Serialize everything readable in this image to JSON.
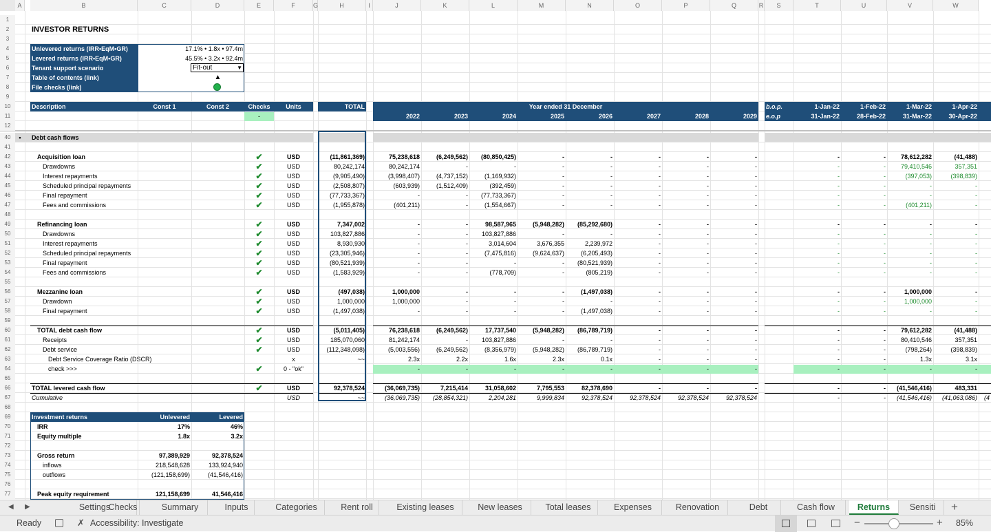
{
  "columns": [
    [
      "A",
      22,
      36
    ],
    [
      "B",
      44,
      200
    ],
    [
      "C",
      200,
      278
    ],
    [
      "D",
      278,
      355
    ],
    [
      "E",
      355,
      398
    ],
    [
      "F",
      398,
      455
    ],
    [
      "G",
      455,
      462
    ],
    [
      "H",
      462,
      532
    ],
    [
      "I",
      532,
      542
    ],
    [
      "J",
      542,
      612
    ],
    [
      "K",
      612,
      682
    ],
    [
      "L",
      682,
      752
    ],
    [
      "M",
      752,
      822
    ],
    [
      "N",
      822,
      892
    ],
    [
      "O",
      892,
      962
    ],
    [
      "P",
      962,
      1032
    ],
    [
      "Q",
      1032,
      1102
    ],
    [
      "R",
      1102,
      1111
    ],
    [
      "S",
      1111,
      1153
    ],
    [
      "T",
      1153,
      1222
    ],
    [
      "U",
      1222,
      1289
    ],
    [
      "V",
      1289,
      1356
    ],
    [
      "W",
      1356,
      1422
    ]
  ],
  "rows": [
    [
      "1",
      22
    ],
    [
      "2",
      36
    ],
    [
      "3",
      50
    ],
    [
      "4",
      64
    ],
    [
      "5",
      78
    ],
    [
      "6",
      92
    ],
    [
      "7",
      106
    ],
    [
      "8",
      120
    ],
    [
      "9",
      134
    ],
    [
      "10",
      148
    ],
    [
      "11",
      162
    ],
    [
      "12",
      176
    ],
    [
      "40",
      193
    ],
    [
      "41",
      207
    ],
    [
      "42",
      221
    ],
    [
      "43",
      235
    ],
    [
      "44",
      249
    ],
    [
      "45",
      263
    ],
    [
      "46",
      277
    ],
    [
      "47",
      291
    ],
    [
      "48",
      305
    ],
    [
      "49",
      319
    ],
    [
      "50",
      333
    ],
    [
      "51",
      347
    ],
    [
      "52",
      361
    ],
    [
      "53",
      375
    ],
    [
      "54",
      389
    ],
    [
      "55",
      403
    ],
    [
      "56",
      417
    ],
    [
      "57",
      431
    ],
    [
      "58",
      445
    ],
    [
      "59",
      459
    ],
    [
      "60",
      473
    ],
    [
      "61",
      487
    ],
    [
      "62",
      501
    ],
    [
      "63",
      515
    ],
    [
      "64",
      529
    ],
    [
      "65",
      543
    ],
    [
      "66",
      557
    ],
    [
      "67",
      571
    ],
    [
      "68",
      585
    ],
    [
      "69",
      599
    ],
    [
      "70",
      613
    ],
    [
      "71",
      627
    ],
    [
      "72",
      641
    ],
    [
      "73",
      655
    ],
    [
      "74",
      669
    ],
    [
      "75",
      683
    ],
    [
      "76",
      697
    ],
    [
      "77",
      711
    ]
  ],
  "title": "INVESTOR RETURNS",
  "summary": {
    "unlev_label": "Unlevered returns (IRR•EqM•GR)",
    "unlev_value": "17.1% • 1.8x • 97.4m",
    "lev_label": "Levered returns (IRR•EqM•GR)",
    "lev_value": "45.5% • 3.2x • 92.4m",
    "tenant_label": "Tenant support scenario",
    "tenant_value": "Fit-out",
    "toc_label": "Table of contents (link)",
    "toc_symbol": "▲",
    "checks_label": "File checks (link)",
    "checks_color": "#22b14c"
  },
  "header": {
    "description": "Description",
    "const1": "Const 1",
    "const2": "Const 2",
    "checks": "Checks",
    "units": "Units",
    "total": "TOTAL",
    "year_ended": "Year ended 31 December",
    "bop": "b.o.p.",
    "eop": "e.o.p",
    "check_dash": "-",
    "years": [
      "2022",
      "2023",
      "2024",
      "2025",
      "2026",
      "2027",
      "2028",
      "2029"
    ],
    "months_bop": [
      "1-Jan-22",
      "1-Feb-22",
      "1-Mar-22",
      "1-Apr-22"
    ],
    "months_eop": [
      "31-Jan-22",
      "28-Feb-22",
      "31-Mar-22",
      "30-Apr-22"
    ]
  },
  "section_bullet": "•",
  "section_label": "Debt cash flows",
  "data_rows": [
    {
      "row": "42",
      "label": "Acquisition loan",
      "indent": 1,
      "bold": true,
      "check": "✔",
      "unit": "USD",
      "total": "(11,861,369)",
      "years": [
        "75,238,618",
        "(6,249,562)",
        "(80,850,425)",
        "-",
        "-",
        "-",
        "-",
        "-"
      ],
      "months": [
        "-",
        "-",
        "78,612,282",
        "(41,488)"
      ]
    },
    {
      "row": "43",
      "label": "Drawdowns",
      "indent": 2,
      "check": "✔",
      "unit": "USD",
      "total": "80,242,174",
      "years": [
        "80,242,174",
        "-",
        "-",
        "-",
        "-",
        "-",
        "-",
        "-"
      ],
      "months": [
        "-",
        "-",
        "79,410,546",
        "357,351"
      ],
      "mgreen": true
    },
    {
      "row": "44",
      "label": "Interest repayments",
      "indent": 2,
      "check": "✔",
      "unit": "USD",
      "total": "(9,905,490)",
      "years": [
        "(3,998,407)",
        "(4,737,152)",
        "(1,169,932)",
        "-",
        "-",
        "-",
        "-",
        "-"
      ],
      "months": [
        "-",
        "-",
        "(397,053)",
        "(398,839)"
      ],
      "mgreen": true
    },
    {
      "row": "45",
      "label": "Scheduled principal repayments",
      "indent": 2,
      "check": "✔",
      "unit": "USD",
      "total": "(2,508,807)",
      "years": [
        "(603,939)",
        "(1,512,409)",
        "(392,459)",
        "-",
        "-",
        "-",
        "-",
        "-"
      ],
      "months": [
        "-",
        "-",
        "-",
        "-"
      ],
      "mgreen": true
    },
    {
      "row": "46",
      "label": "Final repayment",
      "indent": 2,
      "check": "✔",
      "unit": "USD",
      "total": "(77,733,367)",
      "years": [
        "-",
        "-",
        "(77,733,367)",
        "-",
        "-",
        "-",
        "-",
        "-"
      ],
      "months": [
        "-",
        "-",
        "-",
        "-"
      ],
      "mgreen": true
    },
    {
      "row": "47",
      "label": "Fees and commissions",
      "indent": 2,
      "check": "✔",
      "unit": "USD",
      "total": "(1,955,878)",
      "years": [
        "(401,211)",
        "-",
        "(1,554,667)",
        "-",
        "-",
        "-",
        "-",
        "-"
      ],
      "months": [
        "-",
        "-",
        "(401,211)",
        "-"
      ],
      "mgreen": true
    },
    {
      "row": "49",
      "label": "Refinancing loan",
      "indent": 1,
      "bold": true,
      "check": "✔",
      "unit": "USD",
      "total": "7,347,002",
      "years": [
        "-",
        "-",
        "98,587,965",
        "(5,948,282)",
        "(85,292,680)",
        "-",
        "-",
        "-"
      ],
      "months": [
        "-",
        "-",
        "-",
        "-"
      ]
    },
    {
      "row": "50",
      "label": "Drawdowns",
      "indent": 2,
      "check": "✔",
      "unit": "USD",
      "total": "103,827,886",
      "years": [
        "-",
        "-",
        "103,827,886",
        "-",
        "-",
        "-",
        "-",
        "-"
      ],
      "months": [
        "-",
        "-",
        "-",
        "-"
      ],
      "mgreen": true
    },
    {
      "row": "51",
      "label": "Interest repayments",
      "indent": 2,
      "check": "✔",
      "unit": "USD",
      "total": "8,930,930",
      "years": [
        "-",
        "-",
        "3,014,604",
        "3,676,355",
        "2,239,972",
        "-",
        "-",
        "-"
      ],
      "months": [
        "-",
        "-",
        "-",
        "-"
      ],
      "mgreen": true
    },
    {
      "row": "52",
      "label": "Scheduled principal repayments",
      "indent": 2,
      "check": "✔",
      "unit": "USD",
      "total": "(23,305,946)",
      "years": [
        "-",
        "-",
        "(7,475,816)",
        "(9,624,637)",
        "(6,205,493)",
        "-",
        "-",
        "-"
      ],
      "months": [
        "-",
        "-",
        "-",
        "-"
      ],
      "mgreen": true
    },
    {
      "row": "53",
      "label": "Final repayment",
      "indent": 2,
      "check": "✔",
      "unit": "USD",
      "total": "(80,521,939)",
      "years": [
        "-",
        "-",
        "-",
        "-",
        "(80,521,939)",
        "-",
        "-",
        "-"
      ],
      "months": [
        "-",
        "-",
        "-",
        "-"
      ],
      "mgreen": true
    },
    {
      "row": "54",
      "label": "Fees and commissions",
      "indent": 2,
      "check": "✔",
      "unit": "USD",
      "total": "(1,583,929)",
      "years": [
        "-",
        "-",
        "(778,709)",
        "-",
        "(805,219)",
        "-",
        "-",
        "-"
      ],
      "months": [
        "-",
        "-",
        "-",
        "-"
      ],
      "mgreen": true
    },
    {
      "row": "56",
      "label": "Mezzanine loan",
      "indent": 1,
      "bold": true,
      "check": "✔",
      "unit": "USD",
      "total": "(497,038)",
      "years": [
        "1,000,000",
        "-",
        "-",
        "-",
        "(1,497,038)",
        "-",
        "-",
        "-"
      ],
      "months": [
        "-",
        "-",
        "1,000,000",
        "-"
      ]
    },
    {
      "row": "57",
      "label": "Drawdown",
      "indent": 2,
      "check": "✔",
      "unit": "USD",
      "total": "1,000,000",
      "years": [
        "1,000,000",
        "-",
        "-",
        "-",
        "-",
        "-",
        "-",
        "-"
      ],
      "months": [
        "-",
        "-",
        "1,000,000",
        "-"
      ],
      "mgreen": true
    },
    {
      "row": "58",
      "label": "Final repayment",
      "indent": 2,
      "check": "✔",
      "unit": "USD",
      "total": "(1,497,038)",
      "years": [
        "-",
        "-",
        "-",
        "-",
        "(1,497,038)",
        "-",
        "-",
        "-"
      ],
      "months": [
        "-",
        "-",
        "-",
        "-"
      ],
      "mgreen": true
    },
    {
      "row": "60",
      "label": "TOTAL debt cash flow",
      "indent": 1,
      "bold": true,
      "check": "✔",
      "unit": "USD",
      "total": "(5,011,405)",
      "years": [
        "76,238,618",
        "(6,249,562)",
        "17,737,540",
        "(5,948,282)",
        "(86,789,719)",
        "-",
        "-",
        "-"
      ],
      "months": [
        "-",
        "-",
        "79,612,282",
        "(41,488)"
      ]
    },
    {
      "row": "61",
      "label": "Receipts",
      "indent": 2,
      "check": "✔",
      "unit": "USD",
      "total": "185,070,060",
      "years": [
        "81,242,174",
        "-",
        "103,827,886",
        "-",
        "-",
        "-",
        "-",
        "-"
      ],
      "months": [
        "-",
        "-",
        "80,410,546",
        "357,351"
      ]
    },
    {
      "row": "62",
      "label": "Debt service",
      "indent": 2,
      "check": "✔",
      "unit": "USD",
      "total": "(112,348,098)",
      "years": [
        "(5,003,556)",
        "(6,249,562)",
        "(8,356,979)",
        "(5,948,282)",
        "(86,789,719)",
        "-",
        "-",
        "-"
      ],
      "months": [
        "-",
        "-",
        "(798,264)",
        "(398,839)"
      ]
    },
    {
      "row": "63",
      "label": "Debt Service Coverage Ratio (DSCR)",
      "indent": 3,
      "check": "",
      "unit": "x",
      "total": "~~",
      "years": [
        "2.3x",
        "2.2x",
        "1.6x",
        "2.3x",
        "0.1x",
        "-",
        "-",
        "-"
      ],
      "months": [
        "-",
        "-",
        "1.3x",
        "3.1x"
      ]
    },
    {
      "row": "64",
      "label": "check >>>",
      "indent": 3,
      "check": "✔",
      "unit": "0 - \"ok\"",
      "total": "",
      "years": [
        "-",
        "-",
        "-",
        "-",
        "-",
        "-",
        "-",
        "-"
      ],
      "months": [
        "-",
        "-",
        "-",
        "-"
      ]
    },
    {
      "row": "66",
      "label": "TOTAL levered cash flow",
      "indent": 0,
      "bold": true,
      "check": "✔",
      "unit": "USD",
      "total": "92,378,524",
      "years": [
        "(36,069,735)",
        "7,215,414",
        "31,058,602",
        "7,795,553",
        "82,378,690",
        "-",
        "-",
        "-"
      ],
      "months": [
        "-",
        "-",
        "(41,546,416)",
        "483,331"
      ]
    },
    {
      "row": "67",
      "label": "Cumulative",
      "indent": 0,
      "italic": true,
      "check": "",
      "unit": "USD",
      "total": "~~",
      "years": [
        "(36,069,735)",
        "(28,854,321)",
        "2,204,281",
        "9,999,834",
        "92,378,524",
        "92,378,524",
        "92,378,524",
        "92,378,524"
      ],
      "months": [
        "-",
        "-",
        "(41,546,416)",
        "(41,063,086)"
      ],
      "extra": "(4"
    }
  ],
  "inv": {
    "title": "Investment returns",
    "col1": "Unlevered",
    "col2": "Levered",
    "rows": [
      {
        "row": "70",
        "label": "IRR",
        "bold": true,
        "indent": 1,
        "v1": "17%",
        "v2": "46%"
      },
      {
        "row": "71",
        "label": "Equity multiple",
        "bold": true,
        "indent": 1,
        "v1": "1.8x",
        "v2": "3.2x"
      },
      {
        "row": "73",
        "label": "Gross return",
        "bold": true,
        "indent": 1,
        "v1": "97,389,929",
        "v2": "92,378,524"
      },
      {
        "row": "74",
        "label": "inflows",
        "indent": 2,
        "v1": "218,548,628",
        "v2": "133,924,940"
      },
      {
        "row": "75",
        "label": "outflows",
        "indent": 2,
        "v1": "(121,158,699)",
        "v2": "(41,546,416)"
      },
      {
        "row": "77",
        "label": "Peak equity requirement",
        "bold": true,
        "indent": 1,
        "v1": "121,158,699",
        "v2": "41,546,416"
      }
    ]
  },
  "tabs": [
    [
      "Settings",
      77,
      122
    ],
    [
      "Checks",
      155,
      48
    ],
    [
      "Summary",
      222,
      80
    ],
    [
      "Inputs",
      318,
      52
    ],
    [
      "Categories",
      390,
      82
    ],
    [
      "Rent roll",
      487,
      64
    ],
    [
      "Existing leases",
      565,
      107
    ],
    [
      "New leases",
      682,
      90
    ],
    [
      "Total leases",
      783,
      86
    ],
    [
      "Expenses",
      878,
      84
    ],
    [
      "Renovation",
      970,
      88
    ],
    [
      "Debt",
      1070,
      65
    ],
    [
      "Cash flow",
      1143,
      86
    ],
    [
      "Returns",
      1234,
      72
    ],
    [
      "Sensiti",
      1310,
      62
    ]
  ],
  "active_tab": "Returns",
  "add_sheet": "+",
  "status": {
    "ready": "Ready",
    "accessibility": "Accessibility: Investigate",
    "zoom": "85%"
  }
}
